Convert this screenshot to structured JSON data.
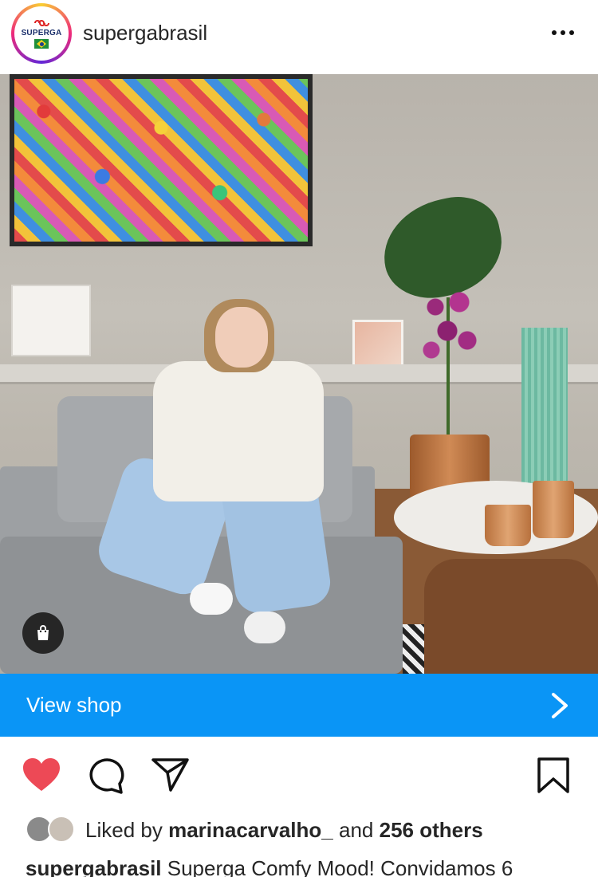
{
  "header": {
    "username": "supergabrasil",
    "logo_text": "SUPERGA"
  },
  "post": {
    "shop_icon": "shopping-bag-icon"
  },
  "view_shop": {
    "label": "View shop"
  },
  "actions": {
    "like_icon": "heart-icon",
    "liked": true,
    "comment_icon": "comment-icon",
    "share_icon": "send-icon",
    "save_icon": "bookmark-icon"
  },
  "likes": {
    "prefix": "Liked by",
    "user": "marinacarvalho_",
    "and": "and",
    "others": "256 others"
  },
  "caption": {
    "username": "supergabrasil",
    "text": "Superga Comfy Mood! Convidamos 6"
  },
  "colors": {
    "shop_bar": "#0a95f6",
    "heart": "#ed4956"
  }
}
